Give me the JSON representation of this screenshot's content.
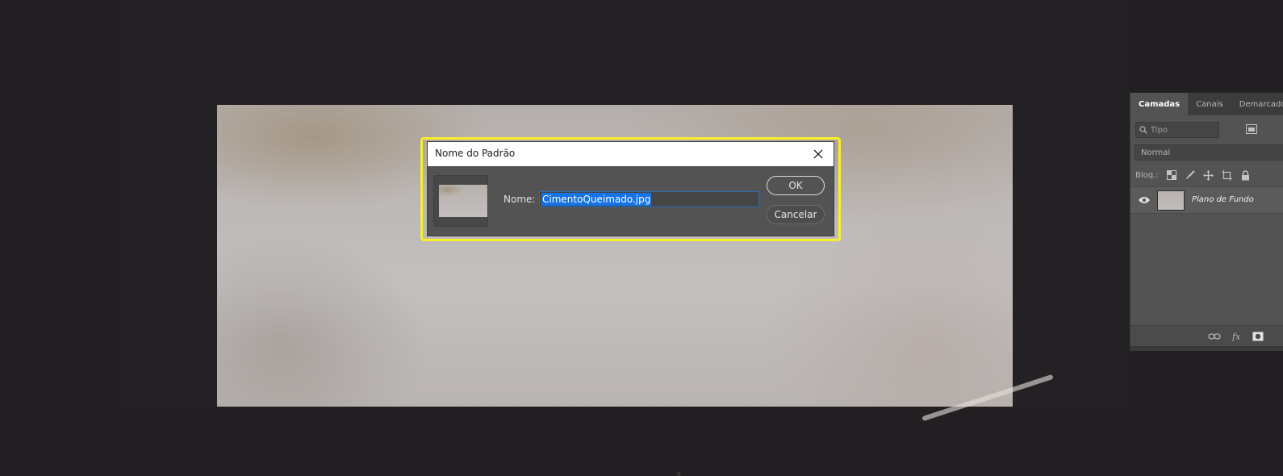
{
  "dialog": {
    "title": "Nome do Padrão",
    "name_label": "Nome:",
    "name_value": "CimentoQueimado.jpg",
    "ok_label": "OK",
    "cancel_label": "Cancelar",
    "highlight_color": "#f7ef2a",
    "selection_color": "#1473e6"
  },
  "layers_panel": {
    "tabs": [
      {
        "label": "Camadas",
        "active": true
      },
      {
        "label": "Canais",
        "active": false
      },
      {
        "label": "Demarcado",
        "active": false
      }
    ],
    "search_placeholder": "Tipo",
    "blend_mode": "Normal",
    "lock_label": "Bloq.:",
    "layers": [
      {
        "name": "Plano de Fundo",
        "visible": true
      }
    ]
  },
  "icons": {
    "close": "close-icon",
    "search": "search-icon",
    "image_filter": "image-filter-icon",
    "lock_transparent": "lock-transparent-pixels-icon",
    "lock_image": "brush-icon",
    "lock_position": "move-icon",
    "lock_artboard": "artboard-icon",
    "lock_all": "lock-icon",
    "visibility": "eye-icon",
    "link": "link-icon",
    "fx": "fx-icon",
    "mask": "mask-icon"
  }
}
